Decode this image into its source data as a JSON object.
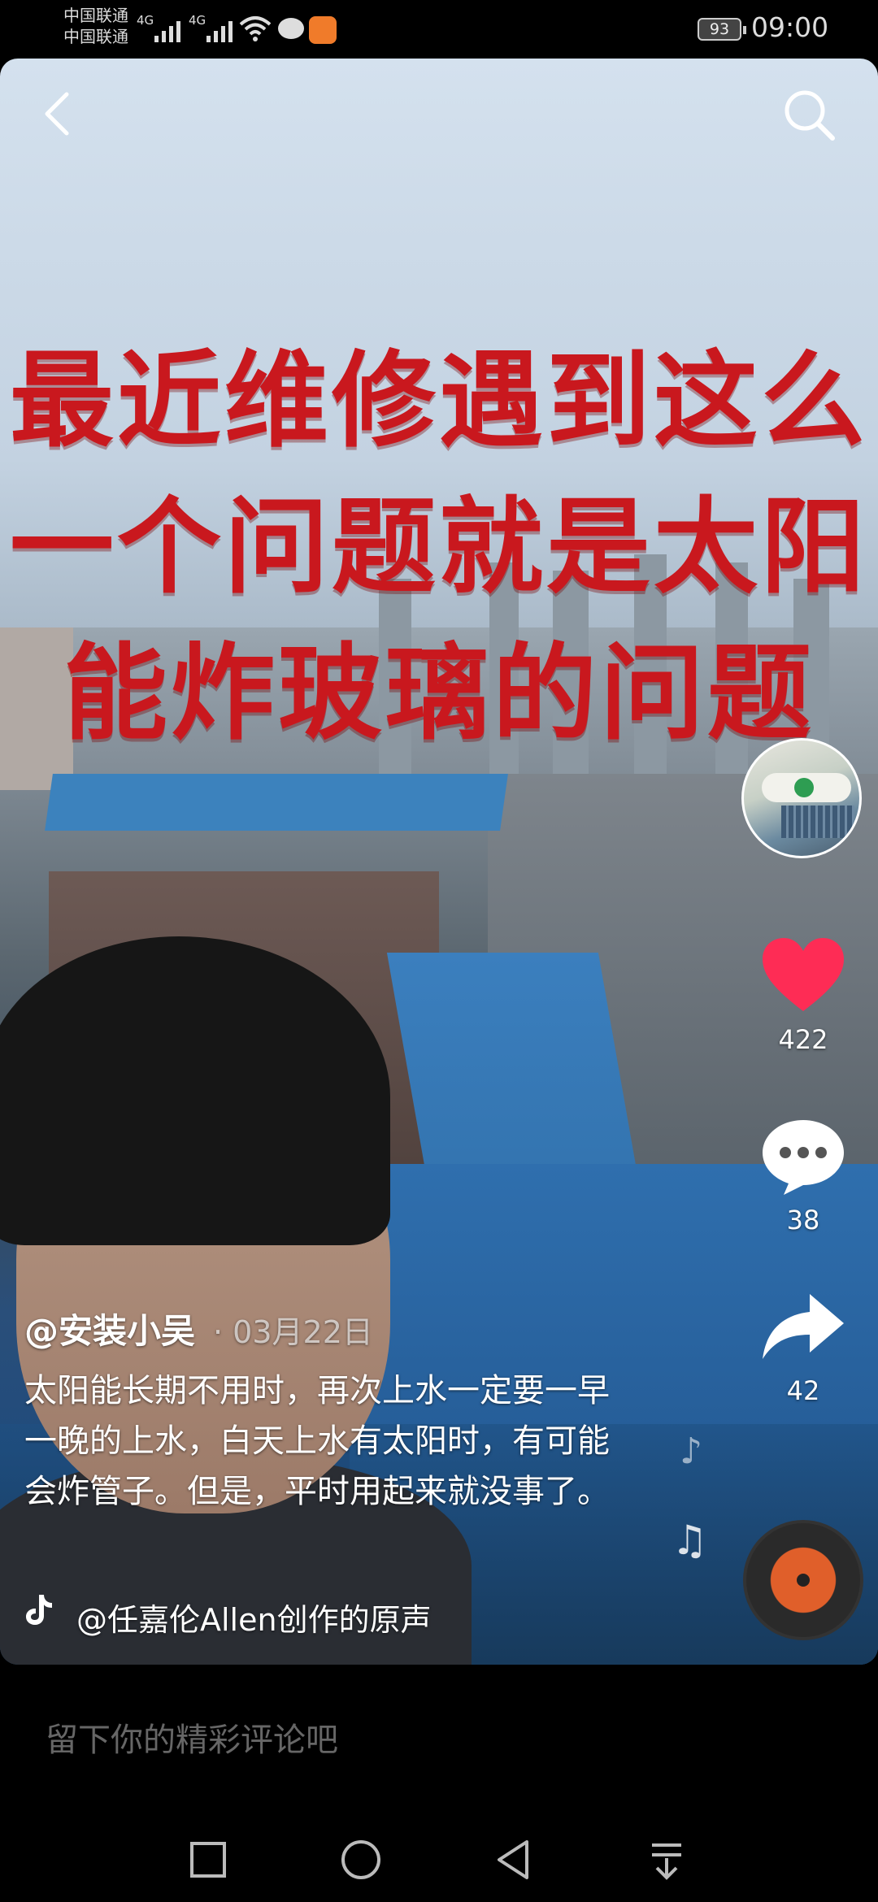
{
  "status_bar": {
    "carrier_1": "中国联通",
    "carrier_2": "中国联通",
    "network_1": "4G",
    "network_2": "4G",
    "battery": "93",
    "time": "09:00"
  },
  "video": {
    "overlay_title_lines": [
      "最近维修遇到这么",
      "一个问题就是太阳",
      "能炸玻璃的问题"
    ],
    "overlay_color": "#c9181e"
  },
  "actions": {
    "like_count": "422",
    "comment_count": "38",
    "share_count": "42",
    "like_color": "#fe2c55"
  },
  "post": {
    "author": "@安装小吴",
    "date": "· 03月22日",
    "description": "太阳能长期不用时，再次上水一定要一早一晚的上水，白天上水有太阳时，有可能会炸管子。但是，平时用起来就没事了。",
    "sound": "@任嘉伦Allen创作的原声"
  },
  "comment_bar": {
    "placeholder": "留下你的精彩评论吧"
  },
  "icons": {
    "back": "chevron-left-icon",
    "search": "search-icon",
    "like": "heart-icon",
    "comment": "comment-icon",
    "share": "share-icon",
    "music": "music-note-icon",
    "nav_recent": "square-icon",
    "nav_home": "circle-icon",
    "nav_back": "triangle-back-icon",
    "nav_notification": "notification-pull-icon"
  }
}
